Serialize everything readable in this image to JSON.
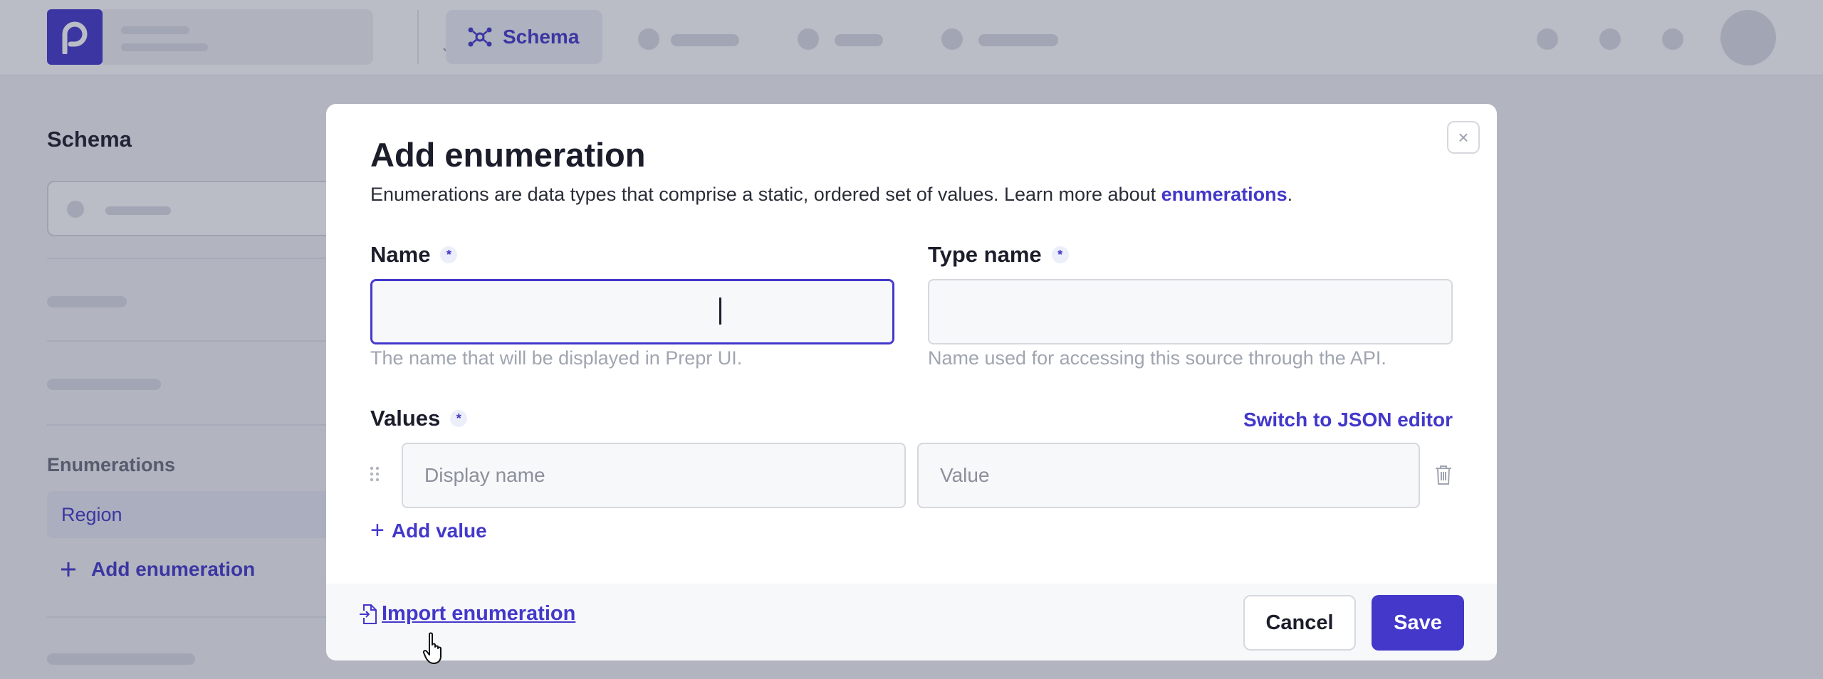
{
  "header": {
    "active_tab": "Schema"
  },
  "sidebar": {
    "title": "Schema",
    "enumerations_heading": "Enumerations",
    "items": [
      {
        "label": "Region"
      }
    ],
    "add_label": "Add enumeration"
  },
  "modal": {
    "title": "Add enumeration",
    "description": "Enumerations are data types that comprise a static, ordered set of values. Learn more about ",
    "description_link": "enumerations",
    "description_end": ".",
    "close_symbol": "×",
    "required_marker": "*",
    "name": {
      "label": "Name",
      "value": "",
      "hint": "The name that will be displayed in Prepr UI."
    },
    "type_name": {
      "label": "Type name",
      "value": "",
      "hint": "Name used for accessing this source through the API."
    },
    "values": {
      "label": "Values",
      "switch_label": "Switch to JSON editor",
      "display_name_placeholder": "Display name",
      "value_placeholder": "Value",
      "add_label": "Add value",
      "add_symbol": "+"
    },
    "footer": {
      "import_label": "Import enumeration",
      "cancel_label": "Cancel",
      "save_label": "Save"
    }
  },
  "colors": {
    "brand": "#4338ca",
    "overlay": "rgba(46,52,82,0.33)"
  },
  "icons": {
    "logo": "prepr-logo-icon",
    "schema": "schema-graph-icon",
    "close": "close-icon",
    "drag": "drag-handle-icon",
    "trash": "trash-icon",
    "plus": "plus-icon",
    "import": "file-import-icon",
    "cursor": "hand-pointer-icon"
  }
}
